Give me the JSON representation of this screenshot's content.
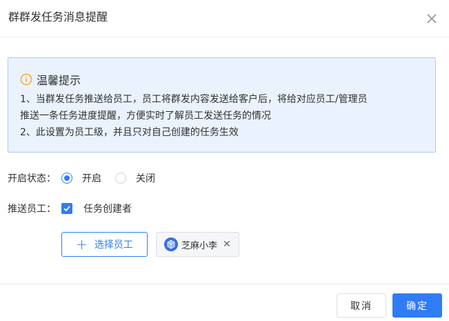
{
  "dialog": {
    "title": "群群发任务消息提醒"
  },
  "notice": {
    "title": "温馨提示",
    "lines": [
      "1、当群发任务推送给员工，员工将群发内容发送给客户后，将给对应员工/管理员",
      "推送一条任务进度提醒，方便实时了解员工发送任务的情况",
      "2、此设置为员工级，并且只对自己创建的任务生效"
    ]
  },
  "form": {
    "status": {
      "label": "开启状态：",
      "options": [
        "开启",
        "关闭"
      ],
      "selected": "开启"
    },
    "push": {
      "label": "推送员工：",
      "checkbox_label": "任务创建者",
      "checked": true,
      "select_button": "选择员工",
      "selected_tags": [
        "芝麻小李"
      ]
    }
  },
  "footer": {
    "cancel": "取消",
    "ok": "确定"
  },
  "colors": {
    "primary": "#2f7cf6",
    "notice_bg": "#eaf2fd",
    "notice_border": "#a9c8f2",
    "info_icon": "#f5a623"
  }
}
